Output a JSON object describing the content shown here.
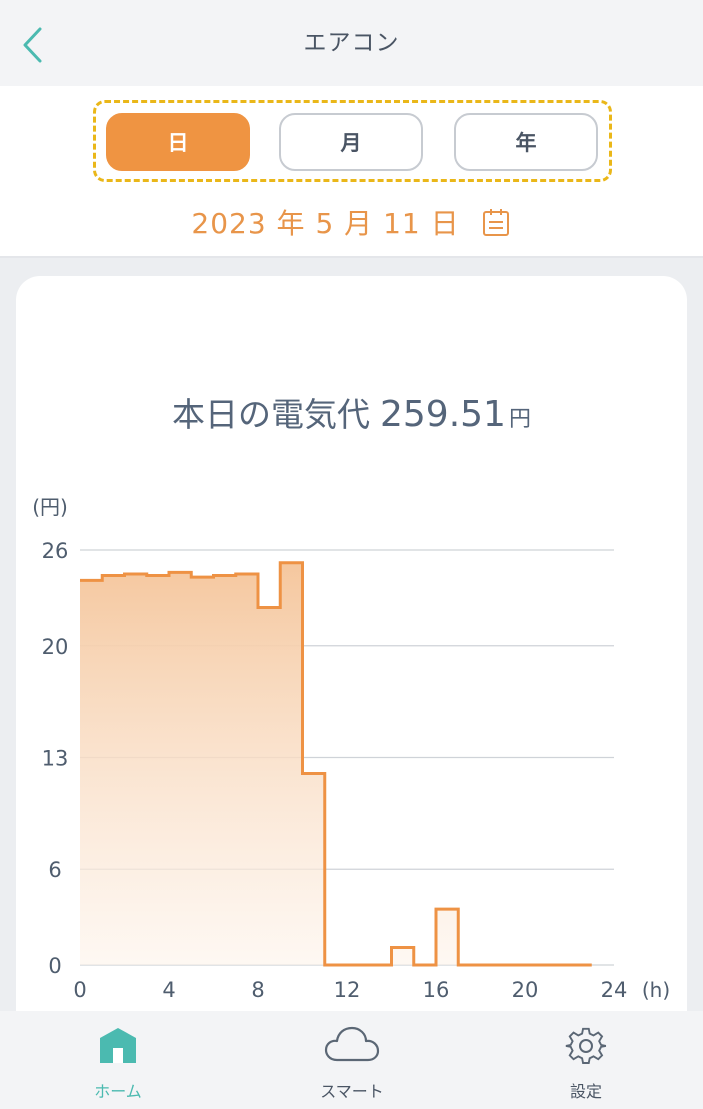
{
  "app_title": "エアコン",
  "period_tabs": [
    {
      "label": "日",
      "active": true
    },
    {
      "label": "月",
      "active": false
    },
    {
      "label": "年",
      "active": false
    }
  ],
  "date_label": "2023 年 5 月 11 日",
  "summary": {
    "label": "本日の電気代",
    "value": "259.51",
    "unit": "円"
  },
  "chart_data": {
    "type": "area",
    "step": true,
    "ylabel": "(円)",
    "xlabel": "(h)",
    "x_ticks": [
      "0",
      "4",
      "8",
      "12",
      "16",
      "20",
      "24"
    ],
    "y_ticks": [
      "26",
      "20",
      "13",
      "6",
      "0"
    ],
    "xlim": [
      0,
      24
    ],
    "ylim": [
      0,
      26
    ],
    "grid": true,
    "series": [
      {
        "x": [
          0,
          1,
          2,
          3,
          4,
          5,
          6,
          7,
          8,
          9,
          10,
          11,
          12,
          13,
          14,
          15,
          16,
          17,
          18,
          19,
          20,
          21,
          22
        ],
        "values": [
          24.1,
          24.4,
          24.5,
          24.4,
          24.6,
          24.3,
          24.4,
          24.5,
          22.4,
          25.2,
          12.0,
          0,
          0,
          0,
          1.1,
          0,
          3.5,
          0,
          0,
          0,
          0,
          0,
          0
        ]
      }
    ],
    "line_color": "#ee9244",
    "fill_color": "#f5c79e"
  },
  "tabbar": [
    {
      "label": "ホーム",
      "icon": "home-icon",
      "active": true
    },
    {
      "label": "スマート",
      "icon": "cloud-icon",
      "active": false
    },
    {
      "label": "設定",
      "icon": "gear-icon",
      "active": false
    }
  ],
  "colors": {
    "accent": "#ef9442",
    "teal": "#4bbab0",
    "highlight": "#eab719"
  }
}
